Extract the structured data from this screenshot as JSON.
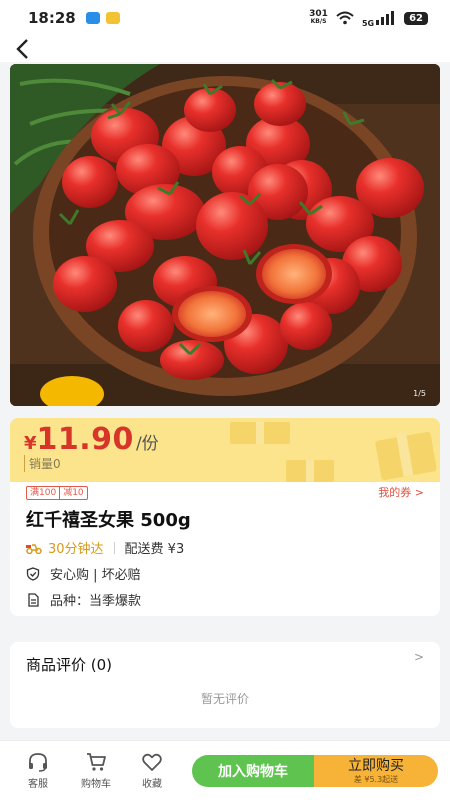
{
  "status_bar": {
    "time": "18:28",
    "net_speed_value": "301",
    "net_speed_unit": "KB/S",
    "network": "5G",
    "battery": "62"
  },
  "nav": {
    "back_icon": "chevron-left-icon"
  },
  "gallery": {
    "index": "1/5"
  },
  "price": {
    "symbol": "¥",
    "value": "11.90",
    "unit": "/份",
    "sales": "销量0"
  },
  "product": {
    "tags": [
      "满100",
      "减10"
    ],
    "coupon_link": "我的券 >",
    "title": "红千禧圣女果 500g",
    "delivery_time": "30分钟达",
    "delivery_fee": "配送费 ¥3",
    "guarantee": "安心购 | 坏必赔",
    "variety": "品种：当季爆款"
  },
  "reviews": {
    "title": "商品评价 (0)",
    "arrow": ">",
    "empty_text": "暂无评价"
  },
  "bottom_bar": {
    "service_label": "客服",
    "cart_label": "购物车",
    "favorite_label": "收藏",
    "add_to_cart": "加入购物车",
    "buy_now": "立即购买",
    "buy_now_sub": "差 ¥5.3起送"
  },
  "colors": {
    "price_red": "#d8352a",
    "banner_yellow": "#fbe48b",
    "cart_green": "#5fc44f",
    "buy_orange": "#f6b338",
    "delivery_gold": "#d79a1b"
  }
}
